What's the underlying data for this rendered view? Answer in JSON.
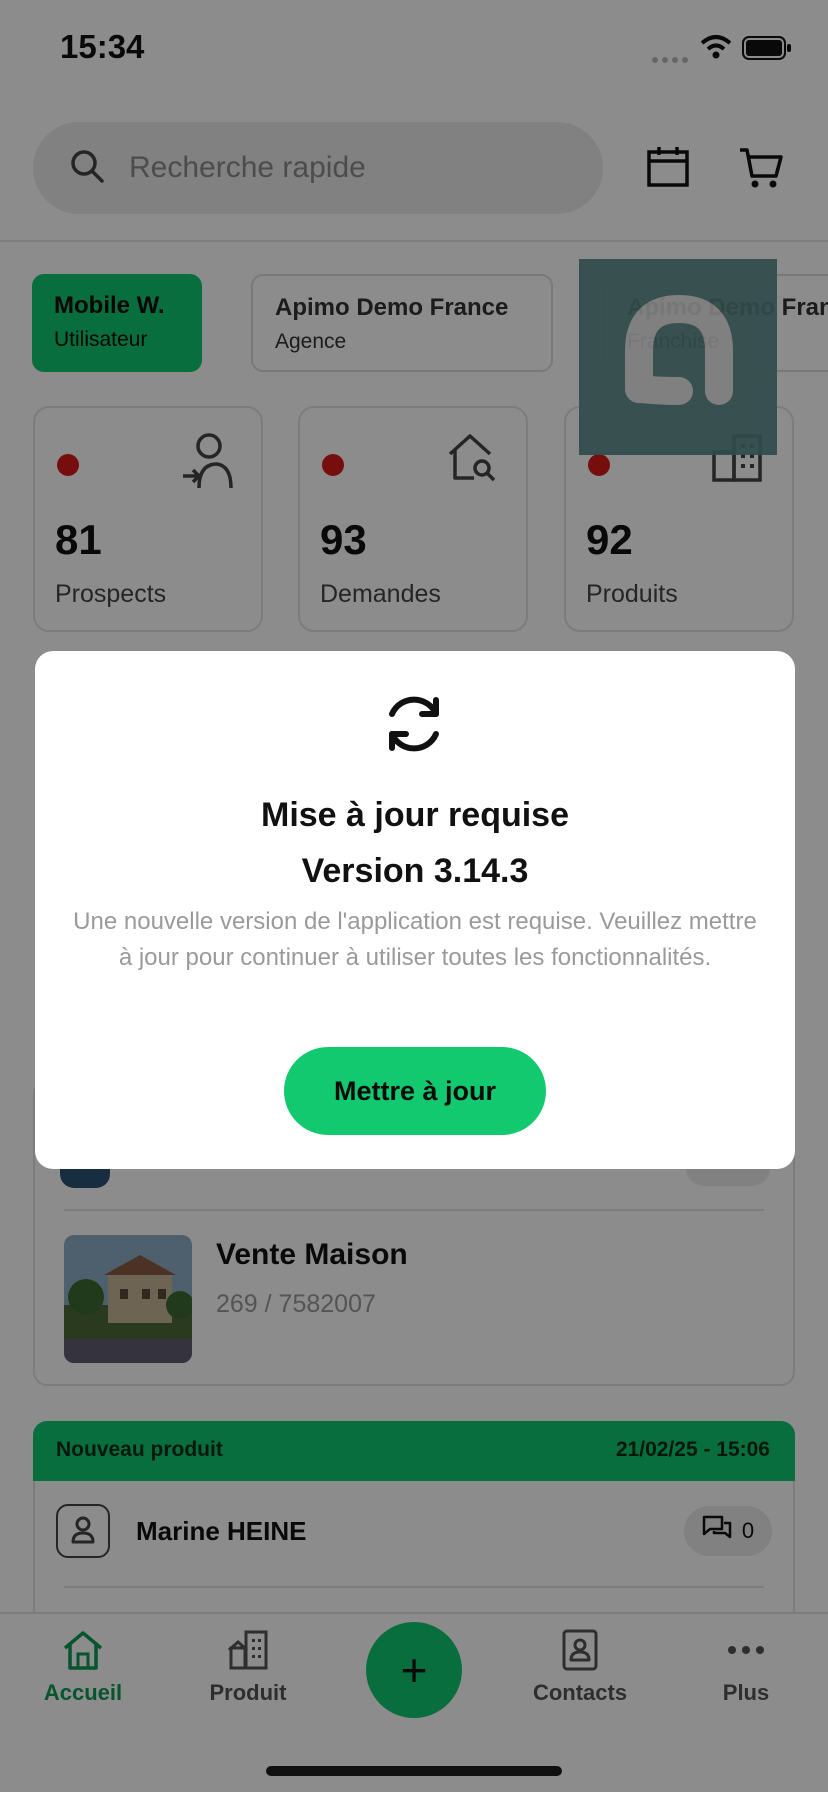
{
  "status_bar": {
    "time": "15:34"
  },
  "search": {
    "placeholder": "Recherche rapide"
  },
  "context": {
    "user": {
      "title": "Mobile W.",
      "subtitle": "Utilisateur"
    },
    "agency": {
      "title": "Apimo Demo France",
      "subtitle": "Agence"
    },
    "franchise": {
      "title": "Apimo Demo France",
      "subtitle": "Franchise"
    }
  },
  "stats": [
    {
      "value": "81",
      "label": "Prospects",
      "icon": "person-arrow-icon"
    },
    {
      "value": "93",
      "label": "Demandes",
      "icon": "house-search-icon"
    },
    {
      "value": "92",
      "label": "Produits",
      "icon": "building-icon"
    }
  ],
  "list": {
    "item": {
      "title": "Vente Maison",
      "ref": "269 / 7582007"
    }
  },
  "new_product": {
    "header": "Nouveau produit",
    "date": "21/02/25 - 15:06",
    "person": "Marine HEINE",
    "comments": "0"
  },
  "nav": {
    "home": "Accueil",
    "product": "Produit",
    "add": "+",
    "contacts": "Contacts",
    "more": "Plus"
  },
  "modal": {
    "title": "Mise à jour requise",
    "version": "Version 3.14.3",
    "message": "Une nouvelle version de l'application est requise. Veuillez mettre à jour pour continuer à utiliser toutes les fonctionnalités.",
    "button": "Mettre à jour"
  },
  "colors": {
    "accent": "#12c96f",
    "alert_dot": "#d81b1b"
  }
}
